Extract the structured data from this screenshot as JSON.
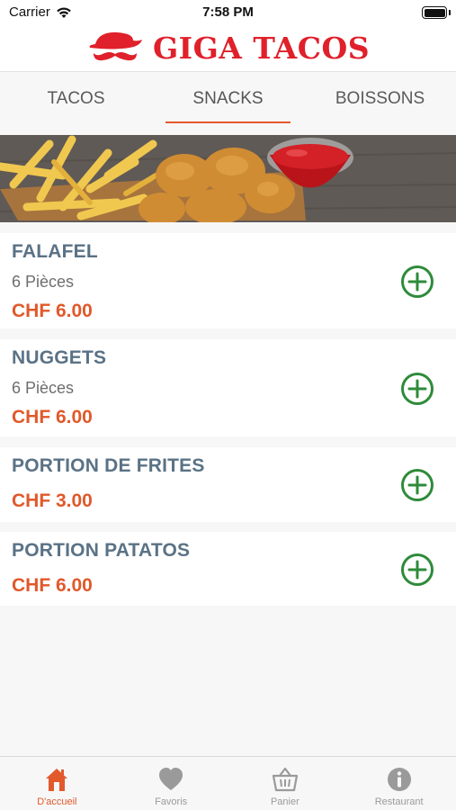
{
  "status": {
    "carrier": "Carrier",
    "time": "7:58 PM"
  },
  "header": {
    "brand": "GIGA TACOS"
  },
  "tabs": [
    {
      "label": "TACOS",
      "active": false
    },
    {
      "label": "SNACKS",
      "active": true
    },
    {
      "label": "BOISSONS",
      "active": false
    }
  ],
  "products": [
    {
      "name": "FALAFEL",
      "description": "6 Pièces",
      "price": "CHF 6.00"
    },
    {
      "name": "NUGGETS",
      "description": "6 Pièces",
      "price": "CHF 6.00"
    },
    {
      "name": "PORTION DE FRITES",
      "description": "",
      "price": "CHF 3.00"
    },
    {
      "name": "PORTION PATATOS",
      "description": "",
      "price": "CHF 6.00"
    }
  ],
  "tabbar": [
    {
      "label": "D'accueil",
      "icon": "home-icon",
      "active": true
    },
    {
      "label": "Favoris",
      "icon": "heart-icon",
      "active": false
    },
    {
      "label": "Panier",
      "icon": "basket-icon",
      "active": false
    },
    {
      "label": "Restaurant",
      "icon": "info-icon",
      "active": false
    }
  ],
  "colors": {
    "accent": "#e5572a",
    "brand": "#e0202a",
    "add_button": "#2e8b3a",
    "product_name": "#5a7285"
  }
}
